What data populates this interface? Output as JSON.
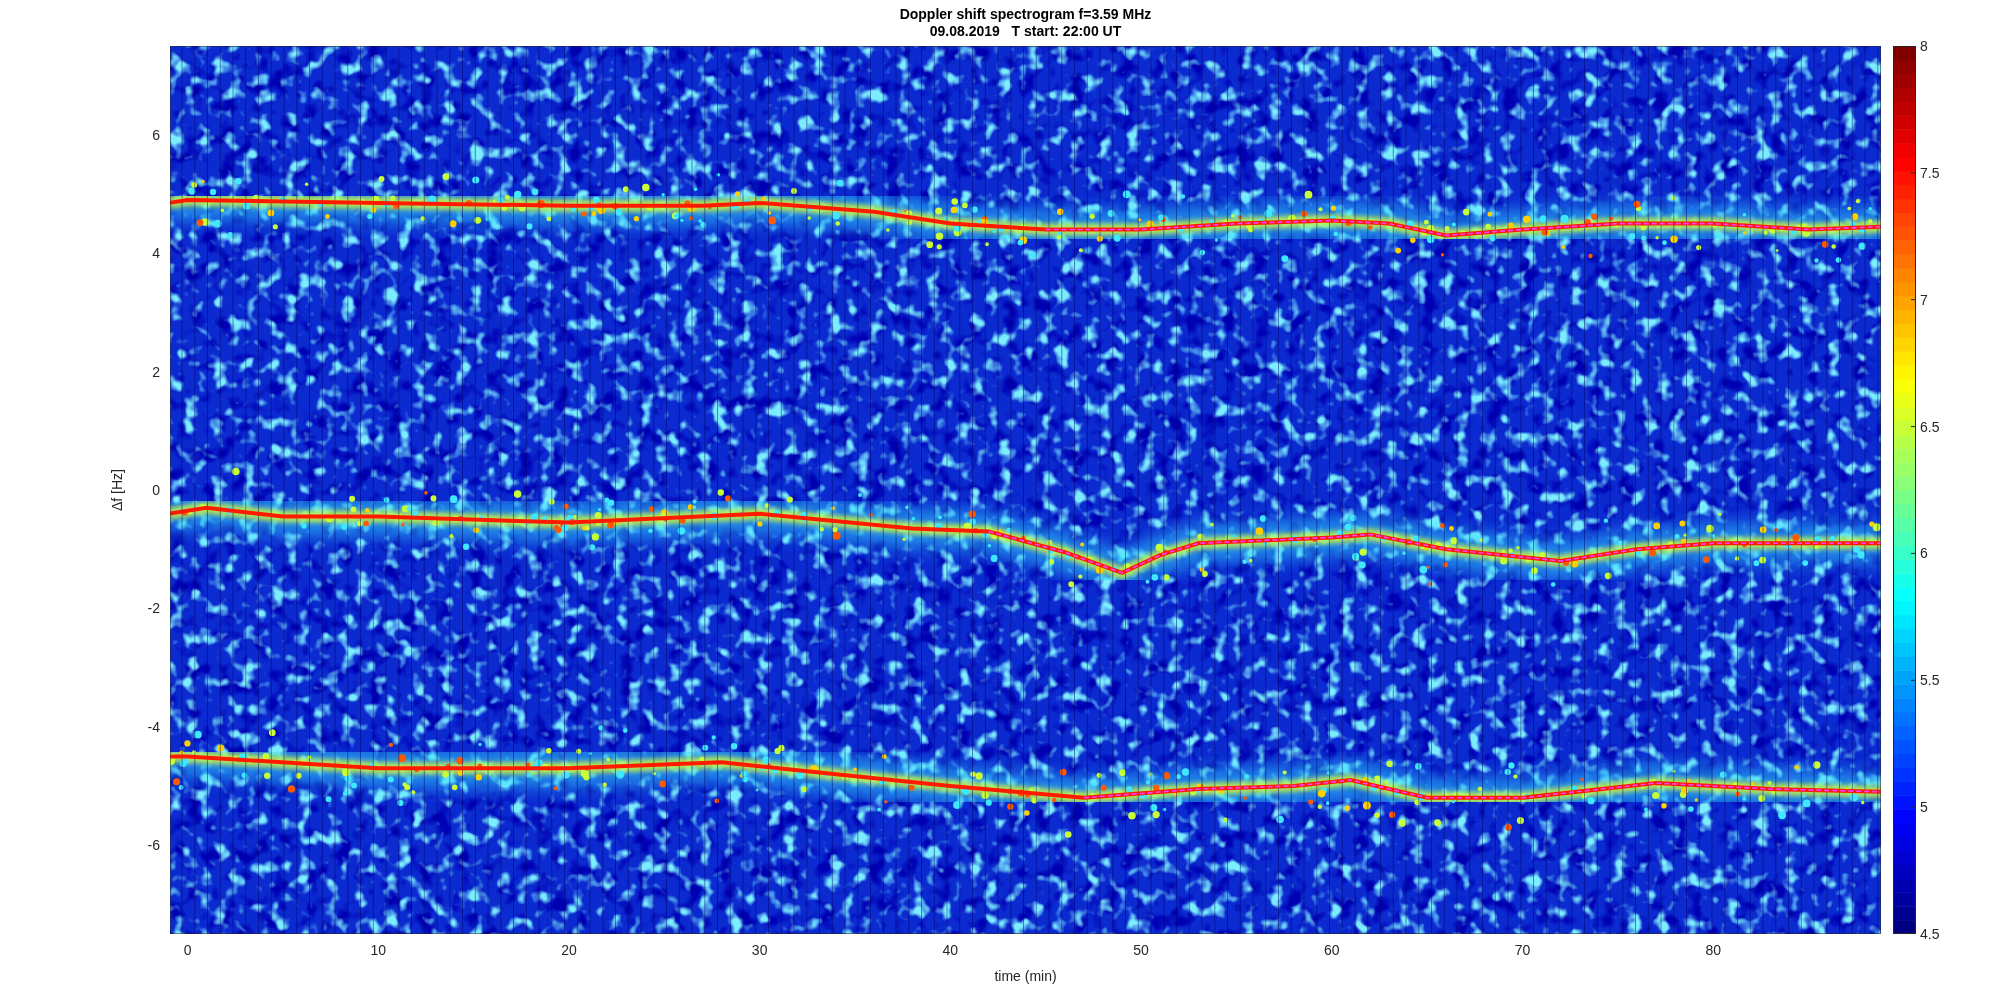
{
  "figure": {
    "title": "Doppler shift spectrogram f=3.59 MHz",
    "subtitle": "09.08.2019   T start: 22:00 UT"
  },
  "axes": {
    "xlabel": "time (min)",
    "ylabel": "Δf [Hz]",
    "xticks": [
      "0",
      "10",
      "20",
      "30",
      "40",
      "50",
      "60",
      "70",
      "80"
    ],
    "yticks": [
      "6",
      "4",
      "2",
      "0",
      "-2",
      "-4",
      "-6"
    ]
  },
  "colorbar": {
    "ticks": [
      "8",
      "7.5",
      "7",
      "6.5",
      "6",
      "5.5",
      "5",
      "4.5"
    ]
  }
}
